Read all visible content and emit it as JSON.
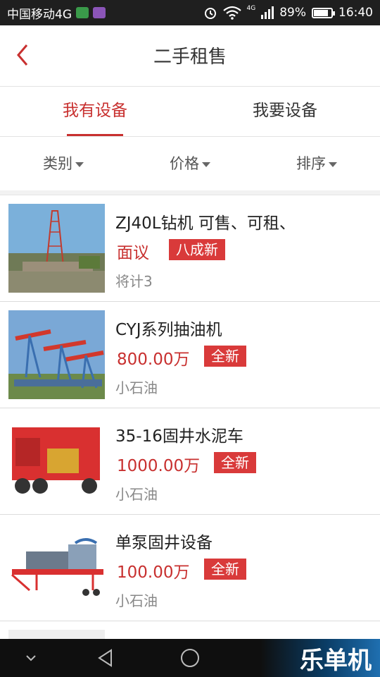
{
  "status_bar": {
    "carrier": "中国移动4G",
    "network_badge": "4G",
    "battery": "89%",
    "battery_level": 0.89,
    "time": "16:40"
  },
  "header": {
    "title": "二手租售"
  },
  "tabs": [
    {
      "label": "我有设备",
      "active": true
    },
    {
      "label": "我要设备",
      "active": false
    }
  ],
  "filters": [
    {
      "label": "类别"
    },
    {
      "label": "价格"
    },
    {
      "label": "排序"
    }
  ],
  "listings": [
    {
      "name": "ZJ40L钻机 可售、可租、",
      "price": "面议",
      "condition": "八成新",
      "seller": "将计3"
    },
    {
      "name": "CYJ系列抽油机",
      "price": "800.00万",
      "condition": "全新",
      "seller": "小石油"
    },
    {
      "name": "35-16固井水泥车",
      "price": "1000.00万",
      "condition": "全新",
      "seller": "小石油"
    },
    {
      "name": "单泵固井设备",
      "price": "100.00万",
      "condition": "全新",
      "seller": "小石油"
    }
  ],
  "watermark": "乐单机",
  "colors": {
    "accent": "#c8302f",
    "badge": "#d93a3a",
    "status_bar": "#1f1f1f"
  }
}
